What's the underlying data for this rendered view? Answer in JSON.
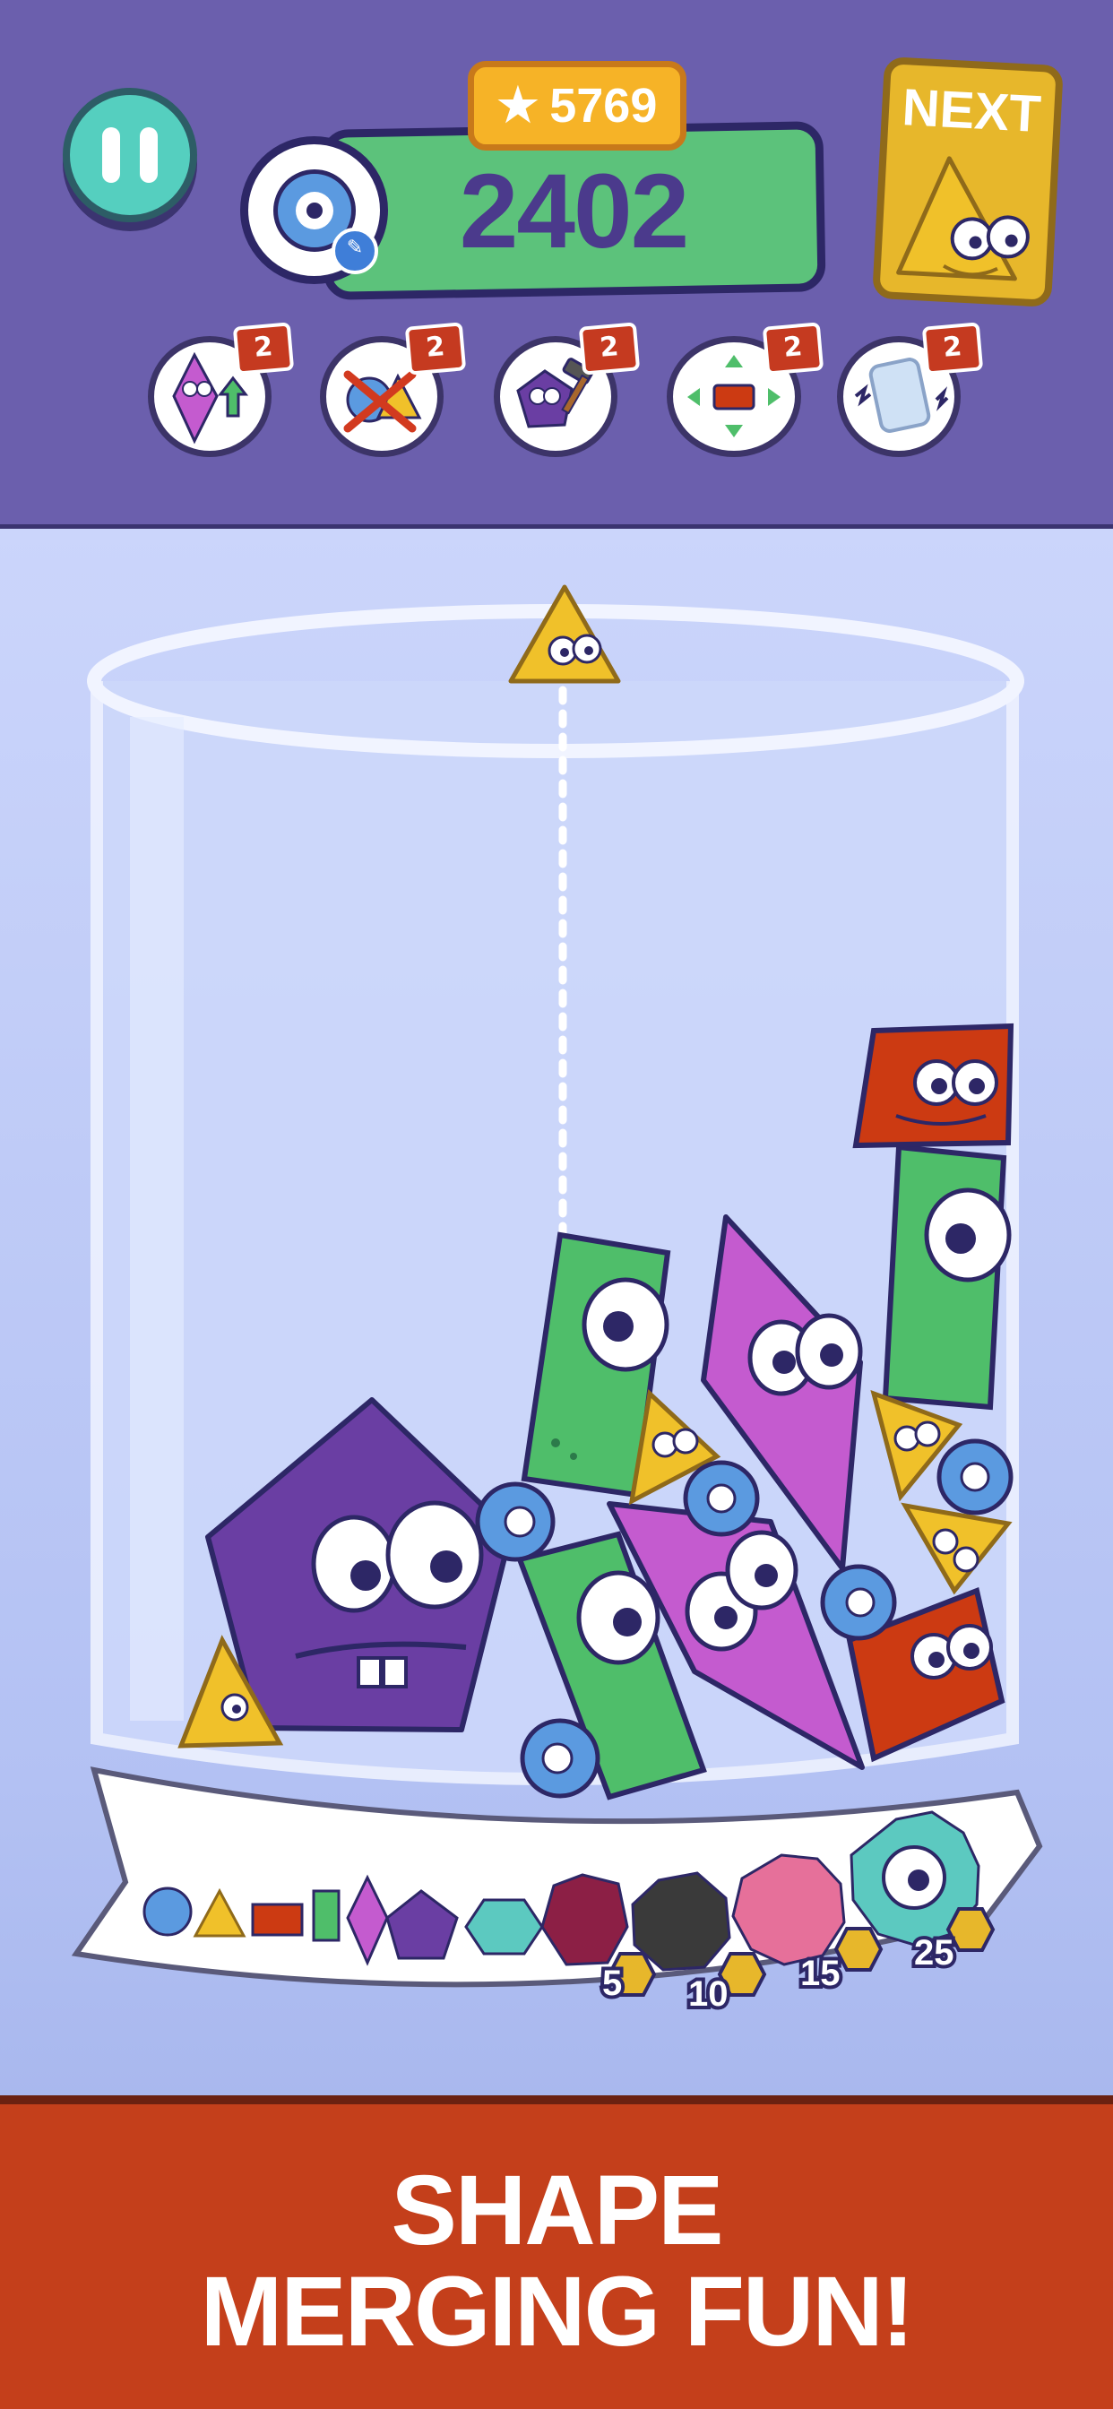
{
  "hud": {
    "coins": "5769",
    "score": "2402",
    "next_label": "NEXT",
    "next_shape": "triangle"
  },
  "icons": {
    "pause": "pause-icon",
    "star": "star-icon",
    "avatar": "eyeball-avatar-icon",
    "edit": "pencil-icon"
  },
  "powerups": [
    {
      "icon": "upgrade-shape-icon",
      "count": "2"
    },
    {
      "icon": "remove-shape-icon",
      "count": "2"
    },
    {
      "icon": "hammer-icon",
      "count": "2"
    },
    {
      "icon": "shake-icon",
      "count": "2"
    },
    {
      "icon": "glass-shake-icon",
      "count": "2"
    }
  ],
  "evolution_chain": {
    "shapes": [
      "circle",
      "triangle",
      "rectangle",
      "tall-rectangle",
      "diamond",
      "pentagon",
      "hexagon",
      "heptagon",
      "octagon",
      "nonagon",
      "decagon"
    ],
    "bonus_values": [
      "5",
      "10",
      "15",
      "25"
    ]
  },
  "promo": {
    "line1": "SHAPE",
    "line2": "MERGING FUN!"
  },
  "colors": {
    "header": "#6b5fad",
    "score_bar": "#5cc27b",
    "coins": "#f6b327",
    "next_card": "#e7b72b",
    "banner": "#c43f1b",
    "green_shape": "#4fbe6a",
    "purple_shape": "#6a3ea3",
    "pink_shape": "#c45bcf",
    "red_shape": "#cc3a12",
    "yellow_shape": "#f0c12a",
    "blue_shape": "#5b9ae0"
  }
}
